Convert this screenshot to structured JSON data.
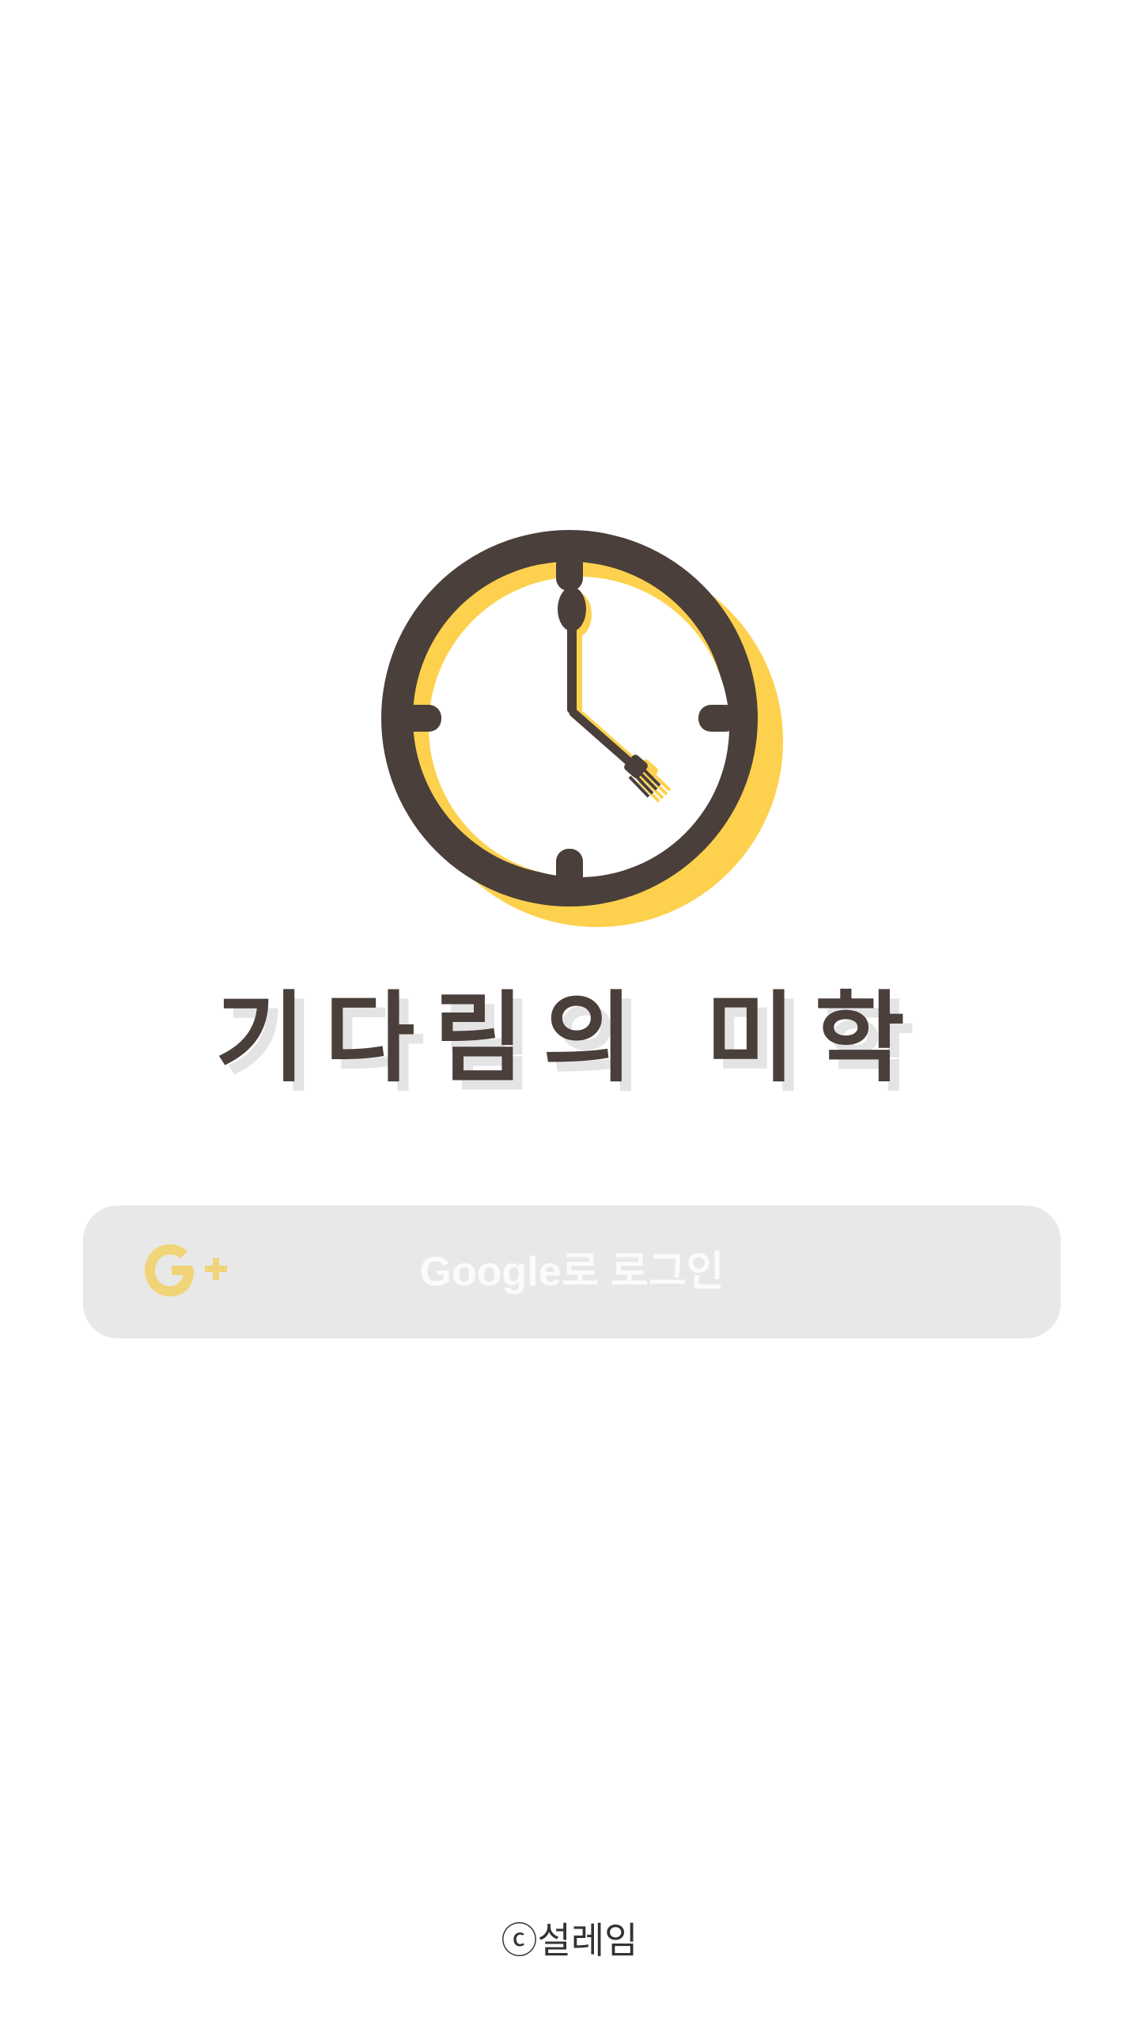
{
  "app": {
    "title": "기다림의 미학"
  },
  "logo": {
    "icon": "clock-spoon-fork-icon",
    "colors": {
      "ring": "#4a3f3a",
      "shadow": "#fdd14d"
    }
  },
  "login": {
    "google_label": "Google로 로그인",
    "icon": "google-plus-icon",
    "icon_color": "#f0d477",
    "button_color": "#e8e8e8"
  },
  "footer": {
    "copyright": "ⓒ설레임"
  }
}
